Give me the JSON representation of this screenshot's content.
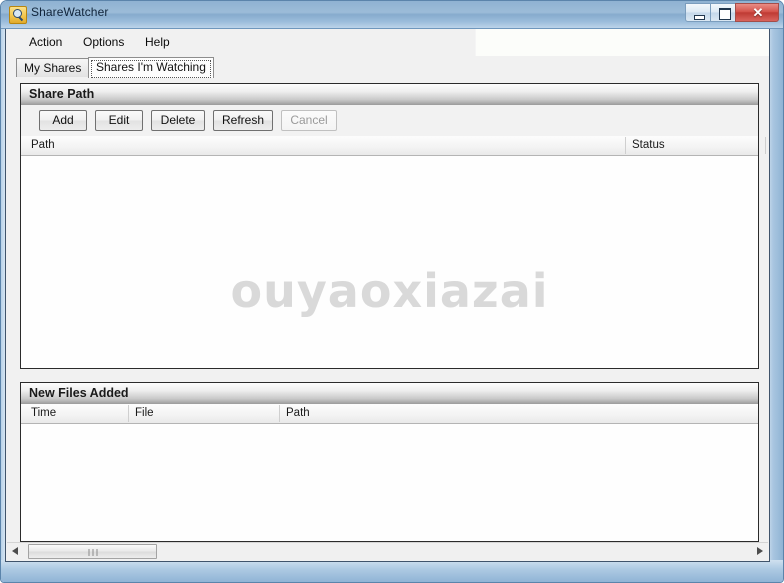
{
  "window": {
    "title": "ShareWatcher",
    "icon": "magnifier-icon",
    "controls": {
      "minimize_label": "",
      "maximize_label": "",
      "close_label": "✕"
    }
  },
  "menu": {
    "items": [
      {
        "label": "Action"
      },
      {
        "label": "Options"
      },
      {
        "label": "Help"
      }
    ]
  },
  "tabs": [
    {
      "label": "My Shares",
      "active": false
    },
    {
      "label": "Shares I'm Watching",
      "active": true
    }
  ],
  "share_path_panel": {
    "title": "Share Path",
    "toolbar": [
      {
        "label": "Add",
        "enabled": true
      },
      {
        "label": "Edit",
        "enabled": true
      },
      {
        "label": "Delete",
        "enabled": true
      },
      {
        "label": "Refresh",
        "enabled": true
      },
      {
        "label": "Cancel",
        "enabled": false
      }
    ],
    "columns": [
      {
        "label": "Path"
      },
      {
        "label": "Status"
      }
    ],
    "rows": []
  },
  "watermark": {
    "text": "ouyaoxiazai"
  },
  "new_files_panel": {
    "title": "New Files Added",
    "columns": [
      {
        "label": "Time"
      },
      {
        "label": "File"
      },
      {
        "label": "Path"
      }
    ],
    "rows": []
  },
  "scrollbar": {
    "left_arrow": "◀",
    "right_arrow": "▶"
  },
  "colors": {
    "titlebar_blue": "#9cbcd8",
    "close_red": "#d4544c",
    "panel_border": "#2b2b2b",
    "watermark_gray": "#d9d9d9",
    "disabled_text": "#9a9a9a"
  }
}
